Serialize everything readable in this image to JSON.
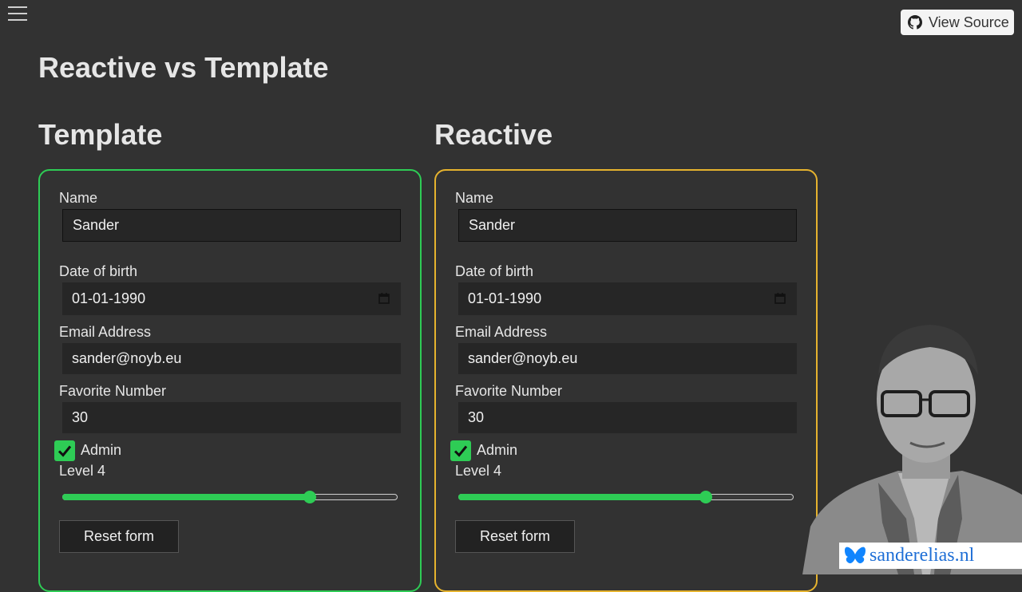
{
  "header": {
    "view_source_label": "View Source",
    "page_title": "Reactive vs Template"
  },
  "forms": {
    "template": {
      "title": "Template",
      "name_label": "Name",
      "name_value": "Sander",
      "dob_label": "Date of birth",
      "dob_value": "01-01-1990",
      "email_label": "Email Address",
      "email_value": "sander@noyb.eu",
      "number_label": "Favorite Number",
      "number_value": "30",
      "admin_label": "Admin",
      "admin_checked": true,
      "level_label": "Level 4",
      "level_fraction": 0.73,
      "reset_label": "Reset form",
      "accent_color": "#2ecc55"
    },
    "reactive": {
      "title": "Reactive",
      "name_label": "Name",
      "name_value": "Sander",
      "dob_label": "Date of birth",
      "dob_value": "01-01-1990",
      "email_label": "Email Address",
      "email_value": "sander@noyb.eu",
      "number_label": "Favorite Number",
      "number_value": "30",
      "admin_label": "Admin",
      "admin_checked": true,
      "level_label": "Level 4",
      "level_fraction": 0.73,
      "reset_label": "Reset form",
      "accent_color": "#e6b32e"
    }
  },
  "branding": {
    "site": "sanderelias.nl",
    "icon": "butterfly-icon"
  }
}
